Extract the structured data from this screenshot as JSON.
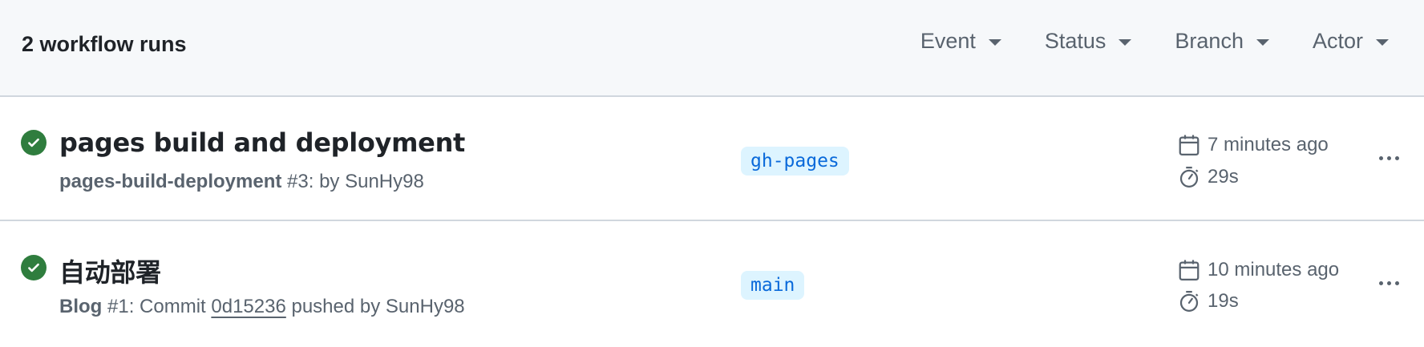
{
  "header": {
    "run_count": "2 workflow runs",
    "filters": [
      "Event",
      "Status",
      "Branch",
      "Actor"
    ]
  },
  "runs": [
    {
      "status": "success",
      "title": "pages build and deployment",
      "workflow": "pages-build-deployment",
      "run_number": "#3",
      "meta_rest": ": by SunHy98",
      "branch": "gh-pages",
      "when": "7 minutes ago",
      "duration": "29s"
    },
    {
      "status": "success",
      "title": "自动部署",
      "workflow": "Blog",
      "run_number": "#1",
      "meta_prefix": ": Commit ",
      "commit": "0d15236",
      "meta_rest": " pushed by SunHy98",
      "branch": "main",
      "when": "10 minutes ago",
      "duration": "19s"
    }
  ],
  "colors": {
    "success": "#2f7d3e",
    "branch_bg": "#ddf4ff",
    "branch_text": "#0969da",
    "muted": "#59636e"
  },
  "icons": [
    "check-circle-icon",
    "calendar-icon",
    "stopwatch-icon",
    "kebab-horizontal-icon",
    "triangle-down-icon"
  ]
}
